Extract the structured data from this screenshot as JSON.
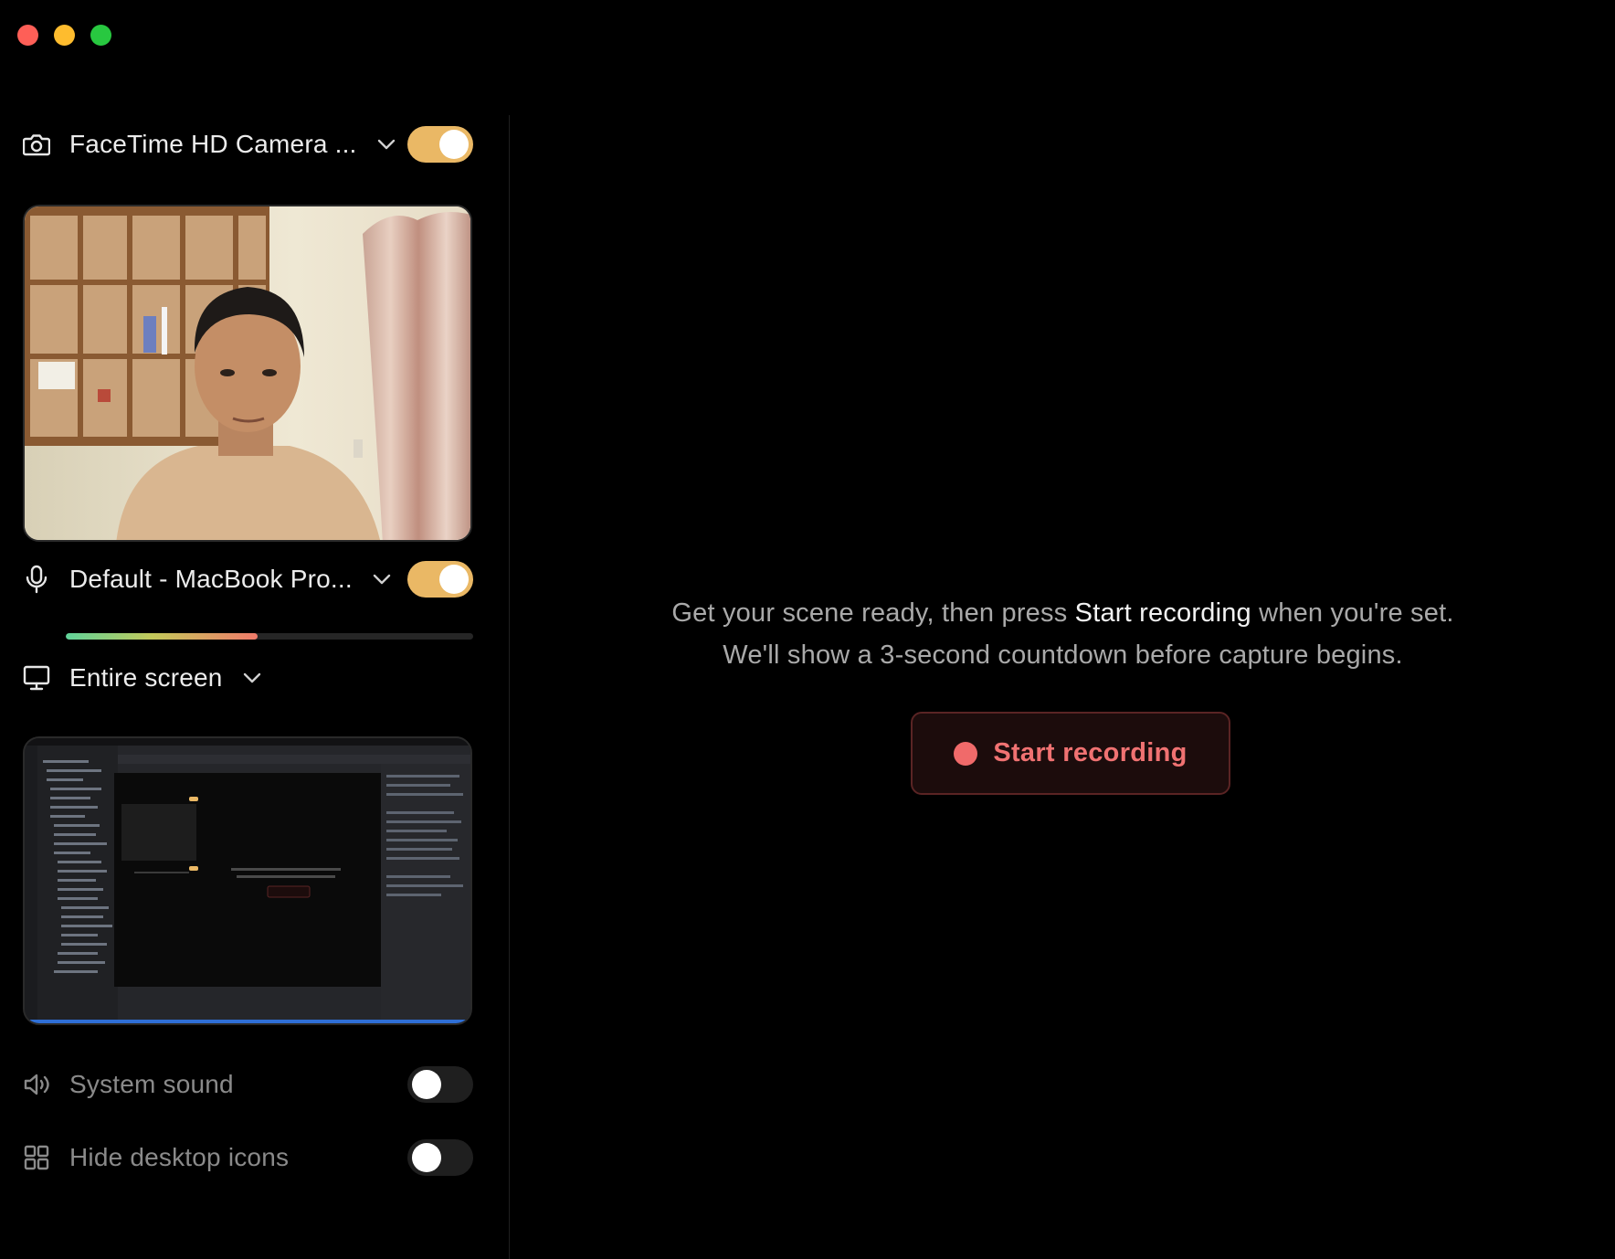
{
  "camera": {
    "label": "FaceTime HD Camera ...",
    "enabled": true,
    "icon": "camera-icon"
  },
  "microphone": {
    "label": "Default - MacBook Pro...",
    "enabled": true,
    "icon": "microphone-icon",
    "level": 0.47
  },
  "screen": {
    "label": "Entire screen",
    "icon": "monitor-icon"
  },
  "system_sound": {
    "label": "System sound",
    "enabled": false,
    "icon": "speaker-icon"
  },
  "hide_desktop_icons": {
    "label": "Hide desktop icons",
    "enabled": false,
    "icon": "grid-icon"
  },
  "main": {
    "line1_pre": "Get your scene ready, then press ",
    "line1_strong": "Start recording",
    "line1_post": " when you're set.",
    "line2": "We'll show a 3-second countdown before capture begins.",
    "record_button": "Start recording"
  },
  "colors": {
    "toggle_on": "#eab865",
    "record_accent": "#f06a6a"
  }
}
